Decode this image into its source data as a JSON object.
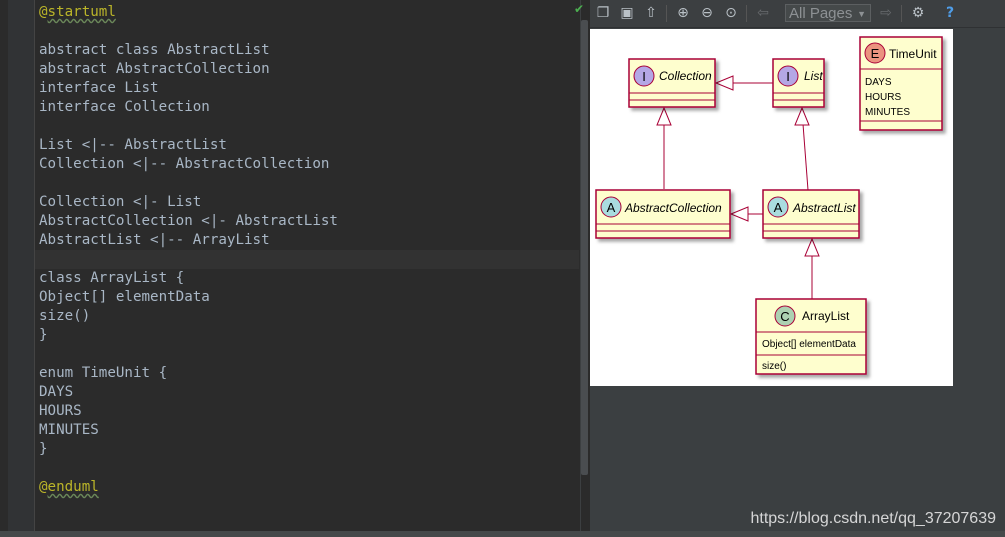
{
  "editor": {
    "lines": [
      {
        "segs": [
          {
            "t": "@",
            "c": "sq2"
          },
          {
            "t": "startuml",
            "c": "sq"
          }
        ]
      },
      {
        "segs": [
          {
            "t": ""
          }
        ]
      },
      {
        "segs": [
          {
            "t": "abstract class AbstractList"
          }
        ]
      },
      {
        "segs": [
          {
            "t": "abstract AbstractCollection"
          }
        ]
      },
      {
        "segs": [
          {
            "t": "interface List"
          }
        ]
      },
      {
        "segs": [
          {
            "t": "interface Collection"
          }
        ]
      },
      {
        "segs": [
          {
            "t": ""
          }
        ]
      },
      {
        "segs": [
          {
            "t": "List <|-- AbstractList"
          }
        ]
      },
      {
        "segs": [
          {
            "t": "Collection <|-- AbstractCollection"
          }
        ]
      },
      {
        "segs": [
          {
            "t": ""
          }
        ]
      },
      {
        "segs": [
          {
            "t": "Collection <|- List"
          }
        ]
      },
      {
        "segs": [
          {
            "t": "AbstractCollection <|- AbstractList"
          }
        ]
      },
      {
        "segs": [
          {
            "t": "AbstractList <|-- ArrayList"
          }
        ]
      },
      {
        "segs": [
          {
            "t": ""
          }
        ],
        "current": true
      },
      {
        "segs": [
          {
            "t": "class ArrayList {"
          }
        ]
      },
      {
        "segs": [
          {
            "t": "Object[] elementData"
          }
        ]
      },
      {
        "segs": [
          {
            "t": "size()"
          }
        ]
      },
      {
        "segs": [
          {
            "t": "}"
          }
        ]
      },
      {
        "segs": [
          {
            "t": ""
          }
        ]
      },
      {
        "segs": [
          {
            "t": "enum TimeUnit {"
          }
        ]
      },
      {
        "segs": [
          {
            "t": "DAYS"
          }
        ]
      },
      {
        "segs": [
          {
            "t": "HOURS"
          }
        ]
      },
      {
        "segs": [
          {
            "t": "MINUTES"
          }
        ]
      },
      {
        "segs": [
          {
            "t": "}"
          }
        ]
      },
      {
        "segs": [
          {
            "t": ""
          }
        ]
      },
      {
        "segs": [
          {
            "t": "@",
            "c": "sq2"
          },
          {
            "t": "enduml",
            "c": "sq"
          }
        ]
      }
    ]
  },
  "toolbar": {
    "pages_label": "All Pages",
    "help_label": "?"
  },
  "diagram": {
    "classes": {
      "collection": {
        "letter": "I",
        "name": "Collection"
      },
      "list": {
        "letter": "I",
        "name": "List"
      },
      "timeunit": {
        "letter": "E",
        "name": "TimeUnit",
        "values": [
          "DAYS",
          "HOURS",
          "MINUTES"
        ]
      },
      "abstract_collection": {
        "letter": "A",
        "name": "AbstractCollection"
      },
      "abstract_list": {
        "letter": "A",
        "name": "AbstractList"
      },
      "arraylist": {
        "letter": "C",
        "name": "ArrayList",
        "field": "Object[] elementData",
        "method": "size()"
      }
    }
  },
  "watermark": "https://blog.csdn.net/qq_37207639",
  "colors": {
    "editor_bg": "#2b2b2b",
    "code_text": "#a9b7c6",
    "annotation": "#bbb529",
    "class_fill": "#fefece",
    "class_border": "#a80036",
    "interface_circle": "#b4a7e5",
    "abstract_circle": "#a9dcdf",
    "enum_circle": "#eb937f",
    "class_circle": "#add1b2"
  }
}
